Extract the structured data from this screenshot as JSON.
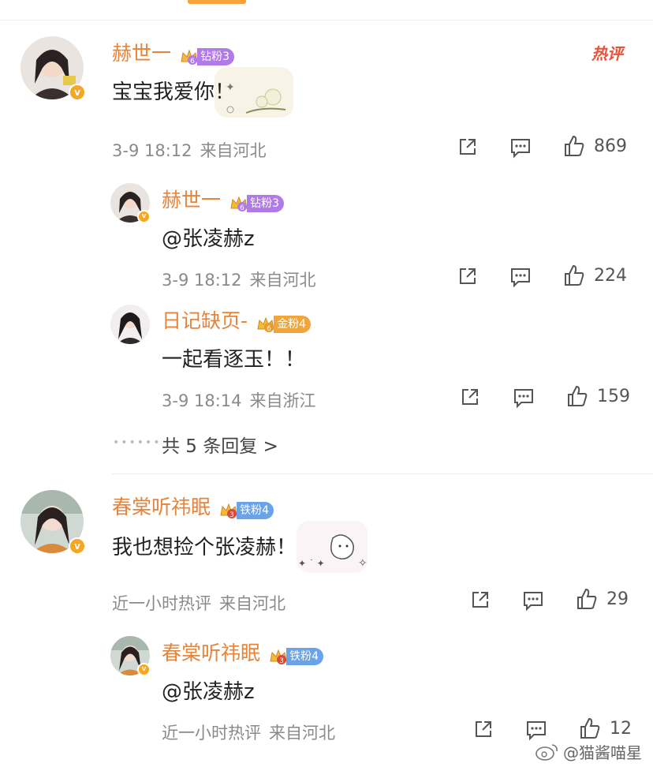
{
  "comments": [
    {
      "name": "赫世一",
      "fan_label": "钻粉3",
      "fan_level_digit": "6",
      "content": "宝宝我爱你！",
      "meta_time": "3-9 18:12",
      "meta_loc": "来自河北",
      "likes": "869",
      "hot_tag": "热评",
      "replies": [
        {
          "name": "赫世一",
          "fan_label": "钻粉3",
          "fan_level_digit": "6",
          "content": "@张凌赫z",
          "meta_time": "3-9 18:12",
          "meta_loc": "来自河北",
          "likes": "224"
        },
        {
          "name": "日记缺页-",
          "fan_label": "金粉4",
          "fan_level_digit": "6",
          "content": "一起看逐玉！！",
          "meta_time": "3-9 18:14",
          "meta_loc": "来自浙江",
          "likes": "159"
        }
      ],
      "more_replies": "共 5 条回复 >"
    },
    {
      "name": "春棠听祎眠",
      "fan_label": "铁粉4",
      "fan_level_digit": "3",
      "content": "我也想捡个张凌赫！",
      "meta_time": "近一小时热评",
      "meta_loc": "来自河北",
      "likes": "29",
      "replies": [
        {
          "name": "春棠听祎眠",
          "fan_label": "铁粉4",
          "fan_level_digit": "3",
          "content": "@张凌赫z",
          "meta_time": "近一小时热评",
          "meta_loc": "来自河北",
          "likes": "12"
        }
      ]
    }
  ],
  "watermark": "@猫酱喵星",
  "icons": {
    "share": "share-icon",
    "comment": "comment-icon",
    "like": "like-icon",
    "crown": "crown-icon",
    "verified": "verified-badge-icon"
  },
  "colors": {
    "accent": "#f7a23b",
    "name": "#e8833a",
    "hot": "#e8533a",
    "diamond_fan": "#b07be8",
    "gold_fan": "#f0a63a",
    "iron_fan": "#6aa3e8"
  }
}
